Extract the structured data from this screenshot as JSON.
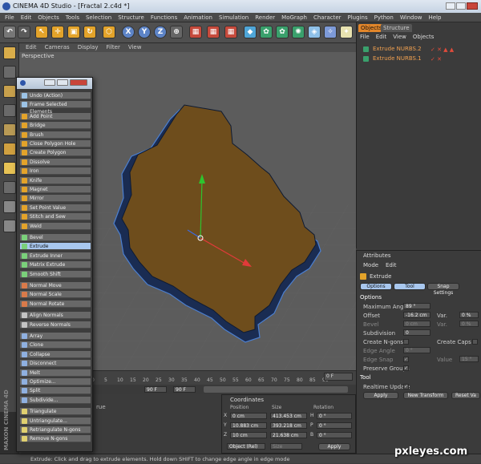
{
  "window": {
    "title": "CINEMA 4D Studio - [Fractal 2.c4d *]"
  },
  "menu": [
    "File",
    "Edit",
    "Objects",
    "Tools",
    "Selection",
    "Structure",
    "Functions",
    "Animation",
    "Simulation",
    "Render",
    "MoGraph",
    "Character",
    "Plugins",
    "Python",
    "Window",
    "Help"
  ],
  "toolbar": {
    "axis_x": "X",
    "axis_y": "Y",
    "axis_z": "Z"
  },
  "viewport": {
    "menu": [
      "Edit",
      "Cameras",
      "Display",
      "Filter",
      "View"
    ],
    "label": "Perspective"
  },
  "timeline": {
    "ticks": [
      "0",
      "5",
      "10",
      "15",
      "20",
      "25",
      "30",
      "35",
      "40",
      "45",
      "50",
      "55",
      "60",
      "65",
      "70",
      "75",
      "80",
      "85",
      "90"
    ],
    "end_frame": "0 F",
    "start_field": "90 F",
    "end_field": "90 F"
  },
  "objects_panel": {
    "tabs": [
      "Objects",
      "Structure"
    ],
    "menu": [
      "File",
      "Edit",
      "View",
      "Objects"
    ],
    "items": [
      "Extrude NURBS.2",
      "Extrude NURBS.1"
    ]
  },
  "attributes_panel": {
    "title": "Attributes",
    "menu": [
      "Mode",
      "Edit"
    ],
    "tool_name": "Extrude",
    "tabs": [
      "Options",
      "Tool",
      "Snap Settings"
    ],
    "options_header": "Options",
    "max_angle_label": "Maximum Angle",
    "max_angle_value": "89 °",
    "offset_label": "Offset",
    "offset_value": "-16.2 cm",
    "var1_label": "Var.",
    "var1_value": "0 %",
    "bevel_label": "Bevel",
    "bevel_value": "0 cm",
    "var2_label": "Var.",
    "var2_value": "0 %",
    "subdivision_label": "Subdivision",
    "subdivision_value": "0",
    "create_ngons_label": "Create N-gons",
    "create_caps_label": "Create Caps",
    "edge_angle_label": "Edge Angle",
    "edge_angle_value": "0 °",
    "edge_snap_label": "Edge Snap",
    "value_label": "Value",
    "value_value": "15 °",
    "preserve_groups_label": "Preserve Groups",
    "tool_header": "Tool",
    "realtime_label": "Realtime Update",
    "apply_label": "Apply",
    "new_transform_label": "New Transform",
    "reset_label": "Reset Va"
  },
  "coordinates": {
    "title": "Coordinates",
    "col_position": "Position",
    "col_size": "Size",
    "col_rotation": "Rotation",
    "rows": [
      {
        "axis": "X",
        "pos": "0 cm",
        "size": "413.453 cm",
        "rot_axis": "H",
        "rot": "0 °"
      },
      {
        "axis": "Y",
        "pos": "10.883 cm",
        "size": "393.218 cm",
        "rot_axis": "P",
        "rot": "0 °"
      },
      {
        "axis": "Z",
        "pos": "10 cm",
        "size": "21.638 cm",
        "rot_axis": "B",
        "rot": "0 °"
      }
    ],
    "mode_select": "Object (Rel)",
    "size_select": "Size",
    "apply_label": "Apply"
  },
  "bottom_left": {
    "label": "rue"
  },
  "popup_menu": {
    "items": [
      "Undo (Action)",
      "Frame Selected Elements",
      "Add Point",
      "Bridge",
      "Brush",
      "Close Polygon Hole",
      "Create Polygon",
      "Dissolve",
      "Iron",
      "Knife",
      "Magnet",
      "Mirror",
      "Set Point Value",
      "Stitch and Sew",
      "Weld",
      "Bevel",
      "Extrude",
      "Extrude Inner",
      "Matrix Extrude",
      "Smooth Shift",
      "Normal Move",
      "Normal Scale",
      "Normal Rotate",
      "Align Normals",
      "Reverse Normals",
      "Array",
      "Clone",
      "Collapse",
      "Disconnect",
      "Melt",
      "Optimize...",
      "Split",
      "Subdivide...",
      "Triangulate",
      "Untriangulate...",
      "Retriangulate N-gons",
      "Remove N-gons"
    ],
    "selected": "Extrude"
  },
  "maxon": {
    "text": "MAXON CINEMA 4D"
  },
  "statusbar": {
    "text": "Extrude: Click and drag to extrude elements. Hold down SHIFT to change edge angle in edge mode"
  },
  "watermark": {
    "text": "pxleyes.com"
  },
  "colors": {
    "accent": "#f39c1e",
    "selection": "#a8c7ee",
    "shape_fill": "#6e4d1c",
    "shape_edge": "#1a2c52"
  }
}
